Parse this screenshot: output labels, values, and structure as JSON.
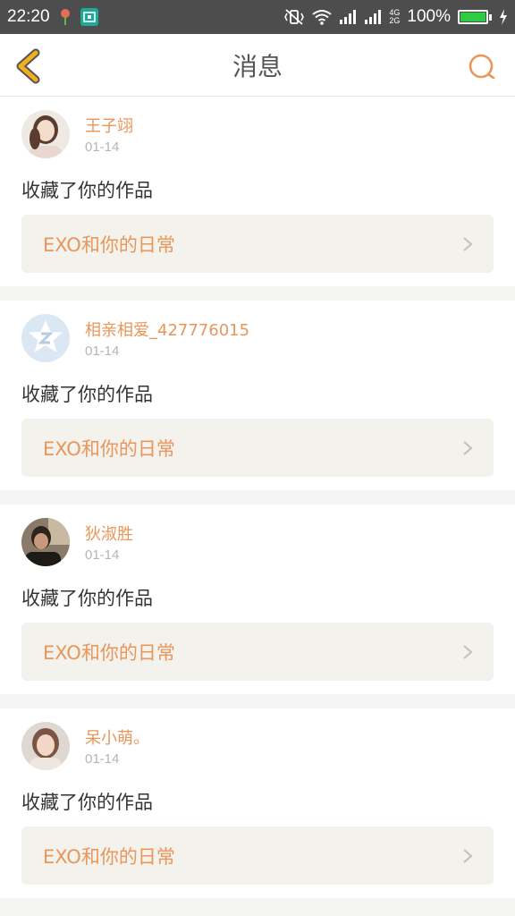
{
  "status_bar": {
    "time": "22:20",
    "battery_percent": "100%",
    "network_label_top": "4G",
    "network_label_bottom": "2G",
    "battery_level": 1.0,
    "icons": [
      "flower-notification-icon",
      "screenshot-app-icon",
      "vibrate-icon",
      "wifi-icon",
      "signal-icon",
      "signal-icon-2",
      "battery-icon",
      "charging-icon"
    ]
  },
  "nav": {
    "title": "消息",
    "back_icon": "chevron-left-icon",
    "search_icon": "search-icon"
  },
  "colors": {
    "accent": "#e8965a",
    "back_icon": "#f2b020",
    "status_bar_bg": "#4d4d4d",
    "link_bg": "#f3f2ec",
    "separator": "#f5f5f3"
  },
  "messages": [
    {
      "username": "王子翊",
      "date": "01-14",
      "action": "收藏了你的作品",
      "work_title": "EXO和你的日常",
      "avatar": "photo-avatar-girl"
    },
    {
      "username": "相亲相爱_427776015",
      "date": "01-14",
      "action": "收藏了你的作品",
      "work_title": "EXO和你的日常",
      "avatar": "default-star-avatar"
    },
    {
      "username": "狄淑胜",
      "date": "01-14",
      "action": "收藏了你的作品",
      "work_title": "EXO和你的日常",
      "avatar": "photo-avatar-man"
    },
    {
      "username": "呆小萌。",
      "date": "01-14",
      "action": "收藏了你的作品",
      "work_title": "EXO和你的日常",
      "avatar": "photo-avatar-girl-2"
    }
  ]
}
